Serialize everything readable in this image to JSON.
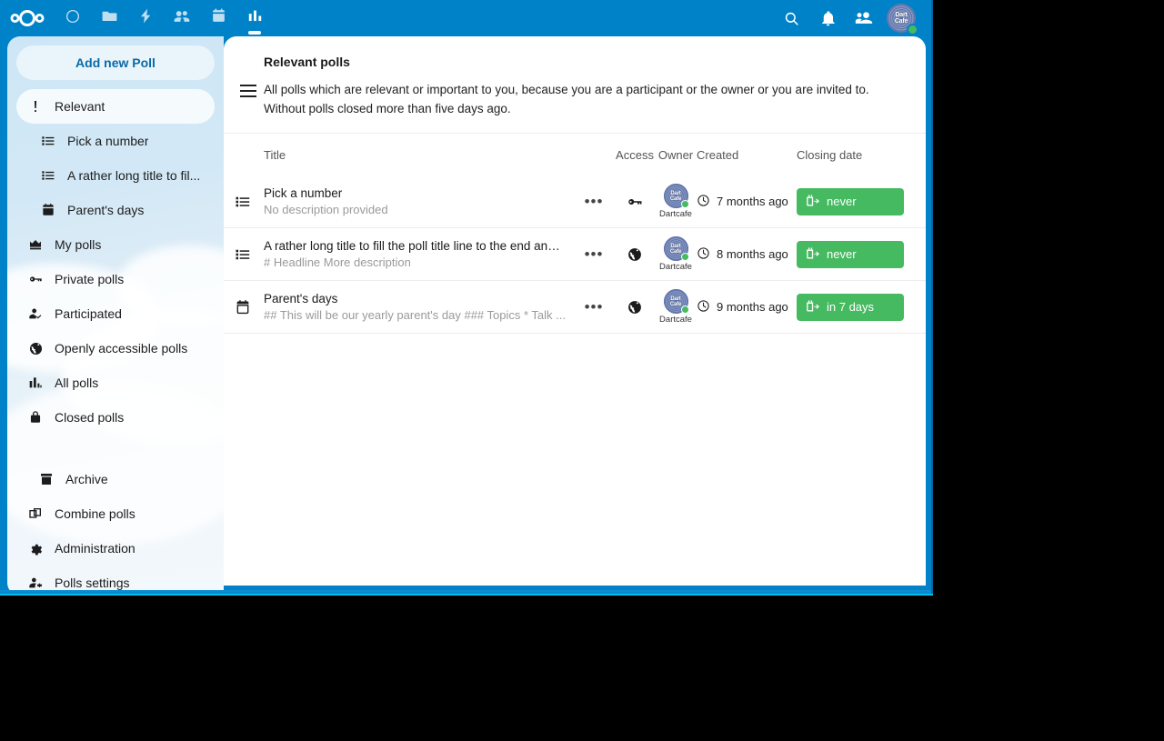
{
  "app": {
    "accent_color": "#0082c9",
    "badge_color": "#46ba61",
    "link_color": "#0b6aa8"
  },
  "header": {
    "logo_name": "nextcloud-logo",
    "nav_apps": [
      {
        "name": "dashboard",
        "icon": "circle-icon",
        "active": false
      },
      {
        "name": "files",
        "icon": "folder-icon",
        "active": false
      },
      {
        "name": "activity",
        "icon": "lightning-icon",
        "active": false
      },
      {
        "name": "contacts",
        "icon": "contacts-icon",
        "active": false
      },
      {
        "name": "calendar",
        "icon": "calendar-icon",
        "active": false
      },
      {
        "name": "polls",
        "icon": "poll-chart-icon",
        "active": true
      }
    ],
    "right_icons": [
      {
        "name": "search-icon"
      },
      {
        "name": "notifications-bell-icon"
      },
      {
        "name": "contacts-menu-icon"
      }
    ],
    "avatar": {
      "initials": "Dart Cafe",
      "line1": "Dart",
      "line2": "Cafe",
      "status": "online"
    }
  },
  "sidebar": {
    "add_poll_label": "Add new Poll",
    "items": [
      {
        "label": "Relevant",
        "icon": "exclamation-icon",
        "active": true,
        "sub": false
      },
      {
        "label": "Pick a number",
        "icon": "list-icon",
        "active": false,
        "sub": true
      },
      {
        "label": "A rather long title to fil...",
        "icon": "list-icon",
        "active": false,
        "sub": true
      },
      {
        "label": "Parent's days",
        "icon": "calendar-icon",
        "active": false,
        "sub": true
      },
      {
        "label": "My polls",
        "icon": "crown-icon",
        "active": false,
        "sub": false
      },
      {
        "label": "Private polls",
        "icon": "key-icon",
        "active": false,
        "sub": false
      },
      {
        "label": "Participated",
        "icon": "account-check-icon",
        "active": false,
        "sub": false
      },
      {
        "label": "Openly accessible polls",
        "icon": "globe-icon",
        "active": false,
        "sub": false
      },
      {
        "label": "All polls",
        "icon": "bar-chart-icon",
        "active": false,
        "sub": false
      },
      {
        "label": "Closed polls",
        "icon": "lock-icon",
        "active": false,
        "sub": false
      }
    ],
    "bottom_items": [
      {
        "label": "Archive",
        "icon": "archive-icon"
      },
      {
        "label": "Combine polls",
        "icon": "combine-icon"
      },
      {
        "label": "Administration",
        "icon": "gear-icon"
      },
      {
        "label": "Polls settings",
        "icon": "account-settings-icon"
      }
    ]
  },
  "main": {
    "menu_icon": "hamburger-icon",
    "title": "Relevant polls",
    "description": "All polls which are relevant or important to you, because you are a participant or the owner or you are invited to. Without polls closed more than five days ago.",
    "table": {
      "columns": {
        "title": "Title",
        "access": "Access",
        "owner": "Owner",
        "created": "Created",
        "closing": "Closing date"
      },
      "rows": [
        {
          "type_icon": "list-icon",
          "title": "Pick a number",
          "description": "No description provided",
          "menu_icon": "dots-horizontal-icon",
          "access_icon": "key-icon",
          "owner_name": "Dartcafe",
          "owner_avatar_line1": "Dart",
          "owner_avatar_line2": "Cafe",
          "owner_status": "online",
          "created_icon": "clock-icon",
          "created": "7 months ago",
          "closing_icon": "calendar-end-icon",
          "closing": "never"
        },
        {
          "type_icon": "list-icon",
          "title": "A rather long title to fill the poll title line to the end and to...",
          "description": "# Headline More description",
          "menu_icon": "dots-horizontal-icon",
          "access_icon": "globe-icon",
          "owner_name": "Dartcafe",
          "owner_avatar_line1": "Dart",
          "owner_avatar_line2": "Cafe",
          "owner_status": "online",
          "created_icon": "clock-icon",
          "created": "8 months ago",
          "closing_icon": "calendar-end-icon",
          "closing": "never"
        },
        {
          "type_icon": "calendar-icon",
          "title": "Parent's days",
          "description": "## This will be our yearly parent's day ### Topics * Talk ...",
          "menu_icon": "dots-horizontal-icon",
          "access_icon": "globe-icon",
          "owner_name": "Dartcafe",
          "owner_avatar_line1": "Dart",
          "owner_avatar_line2": "Cafe",
          "owner_status": "online",
          "created_icon": "clock-icon",
          "created": "9 months ago",
          "closing_icon": "calendar-end-icon",
          "closing": "in 7 days"
        }
      ]
    }
  }
}
